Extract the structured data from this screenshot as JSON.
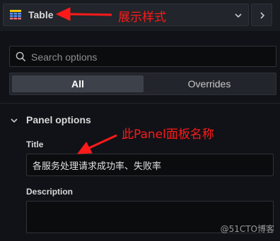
{
  "header": {
    "visualization_label": "Table",
    "icons": {
      "visualization": "table-icon",
      "dropdown": "chevron-down-icon",
      "collapse": "chevron-right-icon"
    }
  },
  "search": {
    "placeholder": "Search options",
    "value": ""
  },
  "tabs": [
    {
      "label": "All",
      "selected": true
    },
    {
      "label": "Overrides",
      "selected": false
    }
  ],
  "panel_options": {
    "section_title": "Panel options",
    "title_label": "Title",
    "title_value": "各服务处理请求成功率、失败率",
    "description_label": "Description",
    "description_value": ""
  },
  "annotations": {
    "arrow_to_visualization": "展示样式",
    "arrow_to_title": "此Panel面板名称",
    "color": "#ff1a1a"
  },
  "watermark": "@51CTO博客",
  "colors": {
    "background": "#111217",
    "tab_selected": "#3d424a",
    "annotation": "#ff1a1a"
  }
}
